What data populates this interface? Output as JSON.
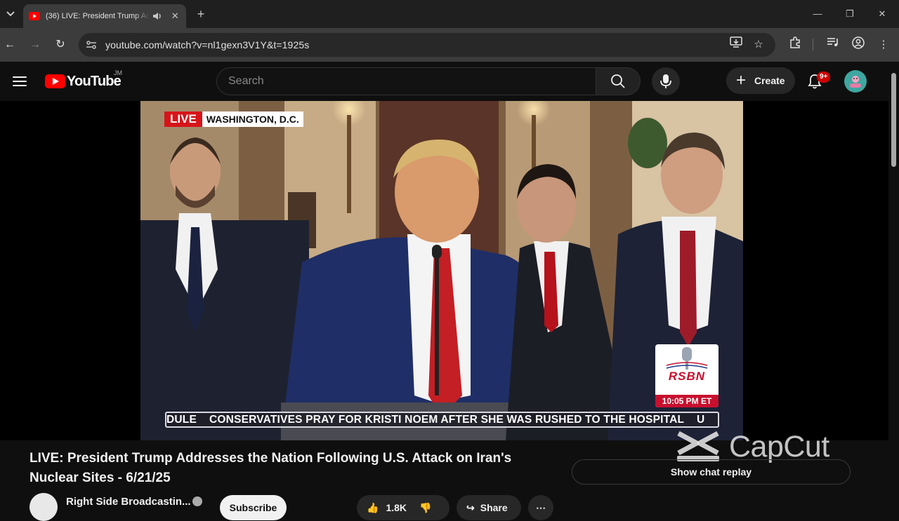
{
  "browser": {
    "tab_title": "(36) LIVE: President Trump Addresses the Nation Following U.S. Attack on Iran's Nuclear Sites",
    "url": "youtube.com/watch?v=nl1gexn3V1Y&t=1925s"
  },
  "youtube": {
    "logo_text": "YouTube",
    "country_code": "JM",
    "search_placeholder": "Search",
    "create_label": "Create",
    "notification_badge": "9+"
  },
  "video": {
    "live_label": "LIVE",
    "location": "WASHINGTON, D.C.",
    "network_logo": "RSBN",
    "network_time": "10:05 PM ET",
    "ticker_text": "DULE    CONSERVATIVES PRAY FOR KRISTI NOEM AFTER SHE WAS RUSHED TO THE HOSPITAL    U",
    "watermark_text": "CapCut",
    "title": "LIVE: President Trump Addresses the Nation Following U.S. Attack on Iran's Nuclear Sites - 6/21/25"
  },
  "channel": {
    "name": "Right Side Broadcastin...",
    "subscribe_label": "Subscribe"
  },
  "actions": {
    "like_count": "1.8K",
    "share_label": "Share"
  },
  "chat": {
    "replay_label": "Show chat replay"
  },
  "colors": {
    "youtube_red": "#ff0000",
    "live_red": "#d7141a",
    "rsbn_red": "#c8102e",
    "notification_red": "#cc0000"
  }
}
